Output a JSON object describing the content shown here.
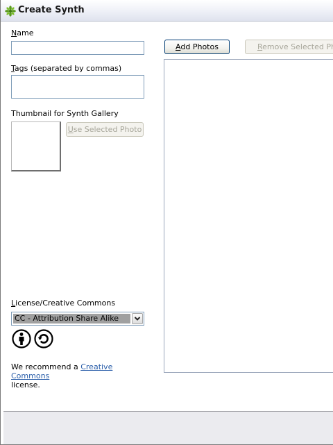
{
  "window": {
    "title": "Create Synth"
  },
  "form": {
    "name_label_first": "N",
    "name_label_rest": "ame",
    "name_value": "",
    "tags_label_first": "T",
    "tags_label_rest": "ags (separated by commas)",
    "tags_value": "",
    "thumbnail_label": "Thumbnail for Synth Gallery",
    "use_selected_photo_first": "U",
    "use_selected_photo_rest": "se Selected Photo"
  },
  "photos": {
    "add_photos_first": "A",
    "add_photos_rest": "dd Photos",
    "remove_selected_first": "R",
    "remove_selected_rest": "emove Selected Photo"
  },
  "license": {
    "label_first": "L",
    "label_rest": "icense/Creative Commons",
    "selected": "CC - Attribution Share Alike",
    "icons": [
      "attribution-icon",
      "share-alike-icon"
    ],
    "recommend_prefix": "We recommend a ",
    "recommend_link": "Creative Commons",
    "recommend_suffix": "license."
  },
  "colors": {
    "accent_border": "#003c74",
    "link": "#2b5faa",
    "logo_green": "#5a9a1e"
  }
}
